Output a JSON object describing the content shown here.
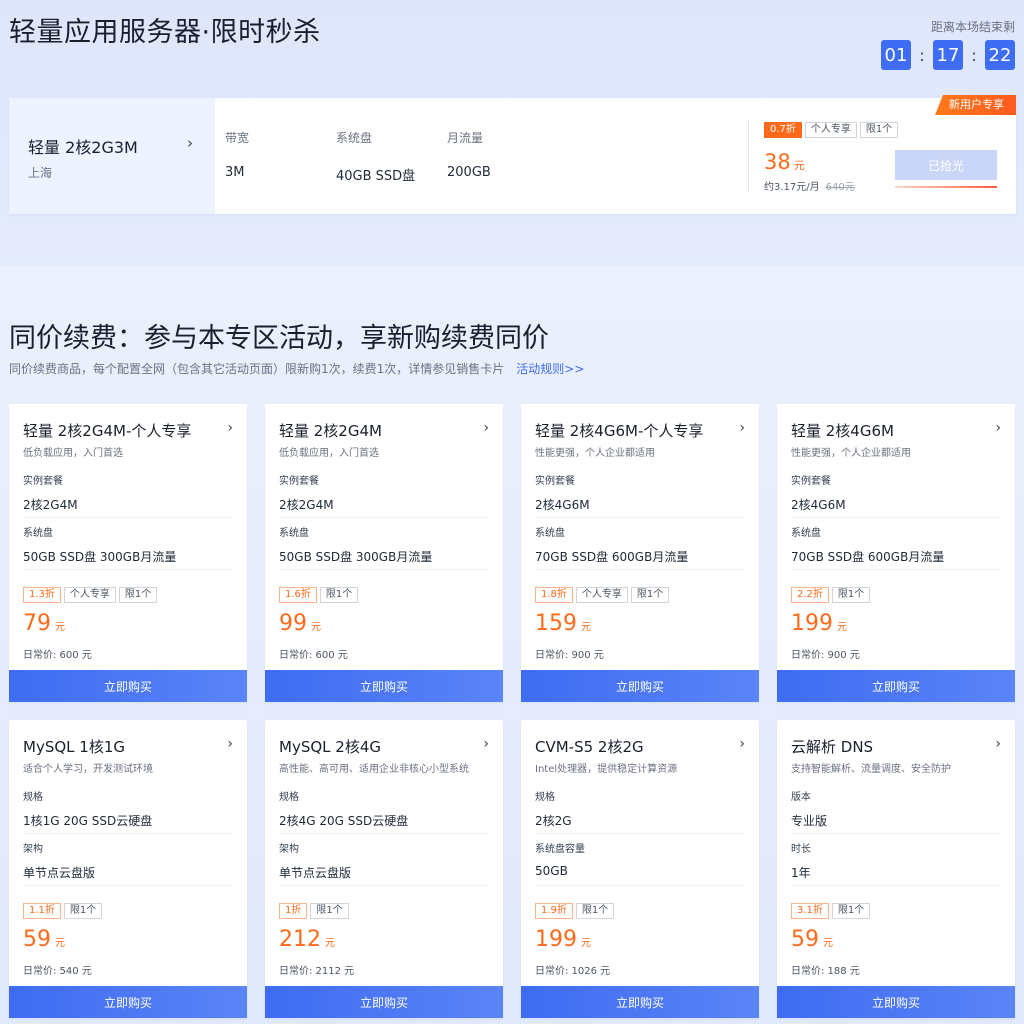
{
  "flash": {
    "title": "轻量应用服务器·限时秒杀",
    "countdown_label": "距离本场结束剩",
    "countdown": [
      "01",
      "17",
      "22"
    ],
    "product": {
      "name": "轻量 2核2G3M",
      "region": "上海",
      "specs": [
        {
          "label": "带宽",
          "value": "3M"
        },
        {
          "label": "系统盘",
          "value": "40GB SSD盘"
        },
        {
          "label": "月流量",
          "value": "200GB"
        }
      ],
      "badge": "新用户专享",
      "tags": [
        "0.7折",
        "个人专享",
        "限1个"
      ],
      "price": "38",
      "unit": "元",
      "monthly": "约3.17元/月",
      "original": "640元",
      "button": "已抢光"
    }
  },
  "renew": {
    "title": "同价续费：参与本专区活动，享新购续费同价",
    "subtitle": "同价续费商品，每个配置全网（包含其它活动页面）限新购1次，续费1次，详情参见销售卡片",
    "rules_link": "活动规则>>"
  },
  "cards": [
    {
      "name": "轻量 2核2G4M-个人专享",
      "desc": "低负载应用，入门首选",
      "k1": "实例套餐",
      "v1": "2核2G4M",
      "k2": "系统盘",
      "v2": "50GB SSD盘 300GB月流量",
      "tags": [
        "1.3折",
        "个人专享",
        "限1个"
      ],
      "price": "79",
      "unit": "元",
      "regular": "日常价: 600 元",
      "button": "立即购买"
    },
    {
      "name": "轻量 2核2G4M",
      "desc": "低负载应用，入门首选",
      "k1": "实例套餐",
      "v1": "2核2G4M",
      "k2": "系统盘",
      "v2": "50GB SSD盘 300GB月流量",
      "tags": [
        "1.6折",
        "限1个"
      ],
      "price": "99",
      "unit": "元",
      "regular": "日常价: 600 元",
      "button": "立即购买"
    },
    {
      "name": "轻量 2核4G6M-个人专享",
      "desc": "性能更强，个人企业都适用",
      "k1": "实例套餐",
      "v1": "2核4G6M",
      "k2": "系统盘",
      "v2": "70GB SSD盘 600GB月流量",
      "tags": [
        "1.8折",
        "个人专享",
        "限1个"
      ],
      "price": "159",
      "unit": "元",
      "regular": "日常价: 900 元",
      "button": "立即购买"
    },
    {
      "name": "轻量 2核4G6M",
      "desc": "性能更强，个人企业都适用",
      "k1": "实例套餐",
      "v1": "2核4G6M",
      "k2": "系统盘",
      "v2": "70GB SSD盘 600GB月流量",
      "tags": [
        "2.2折",
        "限1个"
      ],
      "price": "199",
      "unit": "元",
      "regular": "日常价: 900 元",
      "button": "立即购买"
    },
    {
      "name": "MySQL 1核1G",
      "desc": "适合个人学习，开发测试环境",
      "k1": "规格",
      "v1": "1核1G 20G SSD云硬盘",
      "k2": "架构",
      "v2": "单节点云盘版",
      "tags": [
        "1.1折",
        "限1个"
      ],
      "price": "59",
      "unit": "元",
      "regular": "日常价: 540 元",
      "button": "立即购买"
    },
    {
      "name": "MySQL 2核4G",
      "desc": "高性能、高可用、适用企业非核心小型系统",
      "k1": "规格",
      "v1": "2核4G 20G SSD云硬盘",
      "k2": "架构",
      "v2": "单节点云盘版",
      "tags": [
        "1折",
        "限1个"
      ],
      "price": "212",
      "unit": "元",
      "regular": "日常价: 2112 元",
      "button": "立即购买"
    },
    {
      "name": "CVM-S5 2核2G",
      "desc": "Intel处理器，提供稳定计算资源",
      "k1": "规格",
      "v1": "2核2G",
      "k2": "系统盘容量",
      "v2": "50GB",
      "tags": [
        "1.9折",
        "限1个"
      ],
      "price": "199",
      "unit": "元",
      "regular": "日常价: 1026 元",
      "button": "立即购买"
    },
    {
      "name": "云解析 DNS",
      "desc": "支持智能解析、流量调度、安全防护",
      "k1": "版本",
      "v1": "专业版",
      "k2": "时长",
      "v2": "1年",
      "tags": [
        "3.1折",
        "限1个"
      ],
      "price": "59",
      "unit": "元",
      "regular": "日常价: 188 元",
      "button": "立即购买"
    }
  ],
  "colors": {
    "accent": "#3e6cf2",
    "price": "#ff6a1a",
    "badge": "#ff5a1f"
  },
  "icons": {
    "chevron": "chevron-right-icon"
  }
}
